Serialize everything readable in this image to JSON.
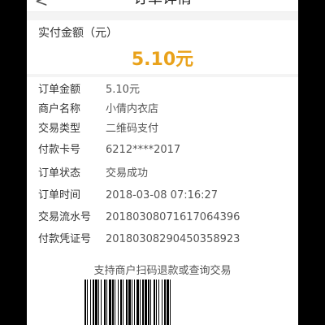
{
  "navbar": {
    "back_label": "<",
    "title": "订单详情"
  },
  "amount_card": {
    "label": "实付金额（元）",
    "value": "5.10元"
  },
  "details": [
    {
      "key": "订单金额",
      "value": "5.10元"
    },
    {
      "key": "商户名称",
      "value": "小倩内衣店"
    },
    {
      "key": "交易类型",
      "value": "二维码支付"
    },
    {
      "key": "付款卡号",
      "value": "6212****2017"
    },
    {
      "key": "订单状态",
      "value": "交易成功"
    },
    {
      "key": "订单时间",
      "value": "2018-03-08 07:16:27"
    },
    {
      "key": "交易流水号",
      "value": "20180308071617064396"
    },
    {
      "key": "付款凭证号",
      "value": "20180308290450358923"
    }
  ],
  "barcode": {
    "hint": "支持商户扫码退款或查询交易",
    "accent": "#000000"
  },
  "colors": {
    "amount": "#e9a21b",
    "background": "#f4f4f4"
  }
}
